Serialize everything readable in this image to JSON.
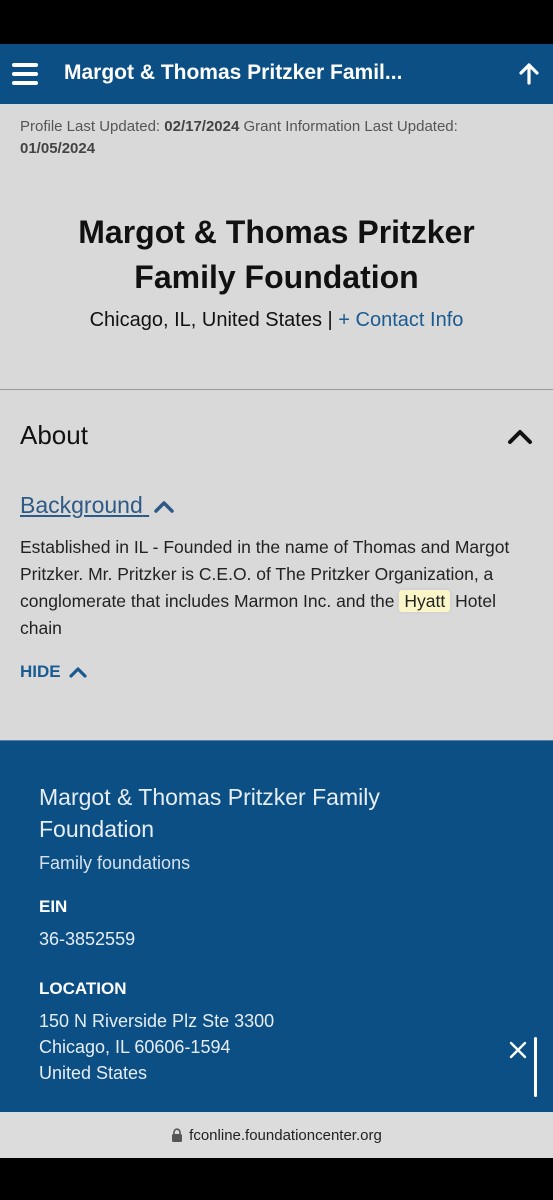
{
  "header": {
    "title": "Margot & Thomas Pritzker Famil..."
  },
  "updated": {
    "profile_label": "Profile Last Updated:",
    "profile_date": "02/17/2024",
    "grant_label": "Grant Information Last Updated:",
    "grant_date": "01/05/2024"
  },
  "org": {
    "title_line1": "Margot & Thomas Pritzker",
    "title_line2": "Family Foundation",
    "location": "Chicago, IL, United States",
    "separator": "|",
    "contact_link": "+ Contact Info"
  },
  "about": {
    "heading": "About",
    "background_link": "Background",
    "text_before": "Established in IL - Founded in the name of Thomas and Margot Pritzker. Mr. Pritzker is C.E.O. of The Pritzker Organization, a conglomerate that includes Marmon Inc. and the ",
    "text_highlight": "Hyatt",
    "text_after": " Hotel chain",
    "hide_label": "HIDE"
  },
  "footer": {
    "name": "Margot & Thomas Pritzker Family Foundation",
    "type": "Family foundations",
    "ein_label": "EIN",
    "ein_value": "36-3852559",
    "location_label": "LOCATION",
    "address_line1": "150 N Riverside Plz Ste 3300",
    "address_line2": "Chicago, IL 60606-1594",
    "address_line3": "United States"
  },
  "browser": {
    "url": "fconline.foundationcenter.org"
  },
  "colors": {
    "brand": "#0b4f85",
    "link": "#1a5b92",
    "page_bg": "#d9d9d9",
    "highlight": "#fbf6c8"
  },
  "icons": [
    "menu-icon",
    "arrow-up-icon",
    "chevron-up-icon",
    "close-icon",
    "lock-icon"
  ]
}
